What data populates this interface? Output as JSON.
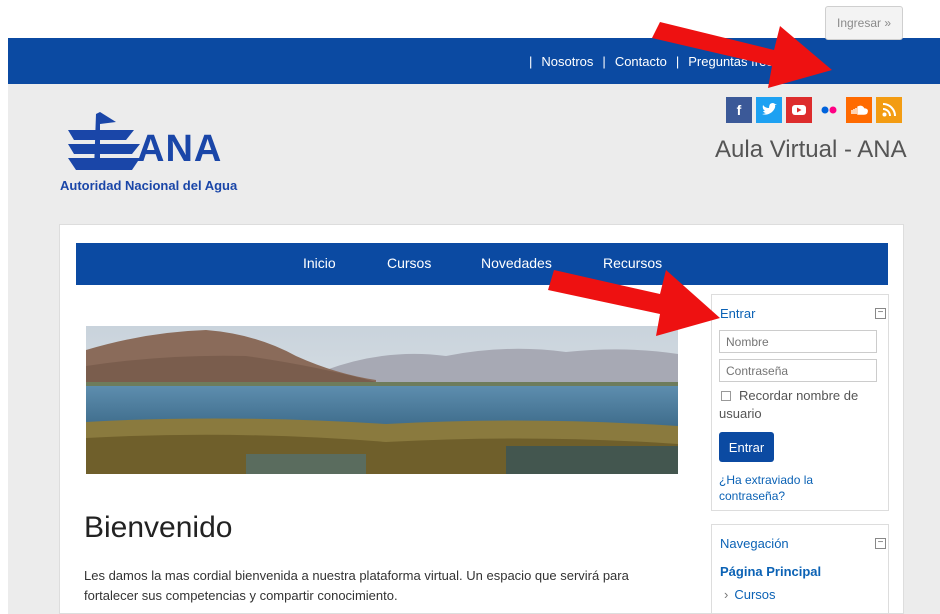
{
  "topnav": {
    "sep": "|",
    "nosotros": "Nosotros",
    "contacto": "Contacto",
    "preguntas": "Preguntas frecuentes",
    "login": "Ingresar »"
  },
  "logo": {
    "name": "ANA",
    "subtitle": "Autoridad Nacional del Agua"
  },
  "social_icons": [
    "facebook-icon",
    "twitter-icon",
    "youtube-icon",
    "flickr-icon",
    "soundcloud-icon",
    "rss-icon"
  ],
  "site_name": "Aula Virtual - ANA",
  "mainnav": {
    "inicio": "Inicio",
    "cursos": "Cursos",
    "novedades": "Novedades",
    "recursos": "Recursos"
  },
  "main": {
    "title": "Bienvenido",
    "intro": "Les damos la mas cordial bienvenida a nuestra plataforma virtual. Un espacio que servirá para fortalecer sus competencias y compartir conocimiento."
  },
  "login_block": {
    "title": "Entrar",
    "collapse": "−",
    "username_placeholder": "Nombre",
    "password_placeholder": "Contraseña",
    "remember_label": "Recordar nombre de usuario",
    "submit": "Entrar",
    "forgot": "¿Ha extraviado la contraseña?"
  },
  "nav_block": {
    "title": "Navegación",
    "collapse": "−",
    "home": "Página Principal",
    "courses_marker": "›",
    "courses": "Cursos"
  },
  "colors": {
    "brand_blue": "#0b4aa2",
    "link_blue": "#0b62b5",
    "annotation_red": "#ee1111"
  }
}
